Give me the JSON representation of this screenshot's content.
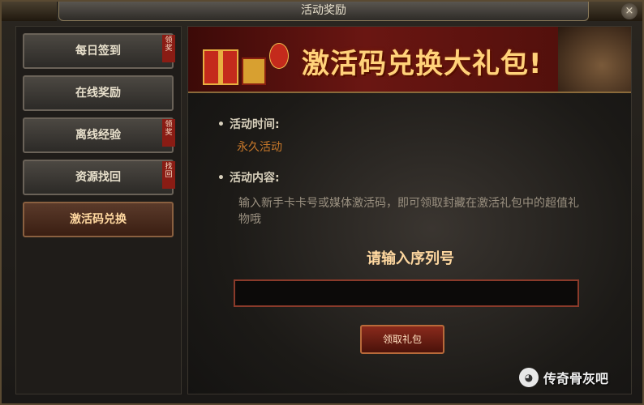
{
  "window": {
    "title": "活动奖励",
    "close_glyph": "×"
  },
  "sidebar": {
    "items": [
      {
        "label": "每日签到",
        "badge": "领奖"
      },
      {
        "label": "在线奖励",
        "badge": ""
      },
      {
        "label": "离线经验",
        "badge": "领奖"
      },
      {
        "label": "资源找回",
        "badge": "找回"
      },
      {
        "label": "激活码兑换",
        "badge": ""
      }
    ],
    "active_index": 4
  },
  "banner": {
    "title": "激活码兑换大礼包!"
  },
  "event": {
    "time_label": "活动时间:",
    "time_value": "永久活动",
    "content_label": "活动内容:",
    "content_text": "输入新手卡卡号或媒体激活码，即可领取封藏在激活礼包中的超值礼物哦"
  },
  "redeem": {
    "prompt": "请输入序列号",
    "input_value": "",
    "button_label": "领取礼包"
  },
  "watermark": {
    "text": "传奇骨灰吧",
    "icon": "wechat-icon"
  }
}
